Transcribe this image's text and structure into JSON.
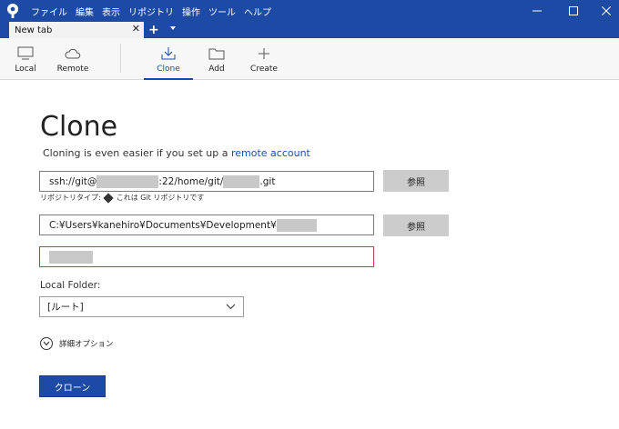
{
  "titlebar": {
    "menu": [
      "ファイル",
      "編集",
      "表示",
      "リポジトリ",
      "操作",
      "ツール",
      "ヘルプ"
    ],
    "controls": {
      "minimize": "—",
      "maximize": "☐",
      "close": "✕"
    }
  },
  "tabs": {
    "active_label": "New tab",
    "close_glyph": "✕",
    "add_glyph": "+"
  },
  "toolbar": {
    "local": "Local",
    "remote": "Remote",
    "clone": "Clone",
    "add": "Add",
    "create": "Create"
  },
  "clone": {
    "title": "Clone",
    "subtitle_text": "Cloning is even easier if you set up a ",
    "subtitle_link": "remote account",
    "source": {
      "prefix": "ssh://git@",
      "middle": ":22/home/git/",
      "suffix": ".git"
    },
    "repo_type_label": "リポジトリタイプ:",
    "repo_type_value": "これは Git リポジトリです",
    "browse_label_1": "参照",
    "destination": {
      "prefix": "C:¥Users¥kanehiro¥Documents¥Development¥"
    },
    "browse_label_2": "参照",
    "local_folder_label": "Local Folder:",
    "local_folder_value": "[ルート]",
    "advanced_label": "詳細オプション",
    "clone_button": "クローン"
  },
  "colors": {
    "accent": "#1d4aa5",
    "name_field_border": "#b04a4a"
  }
}
